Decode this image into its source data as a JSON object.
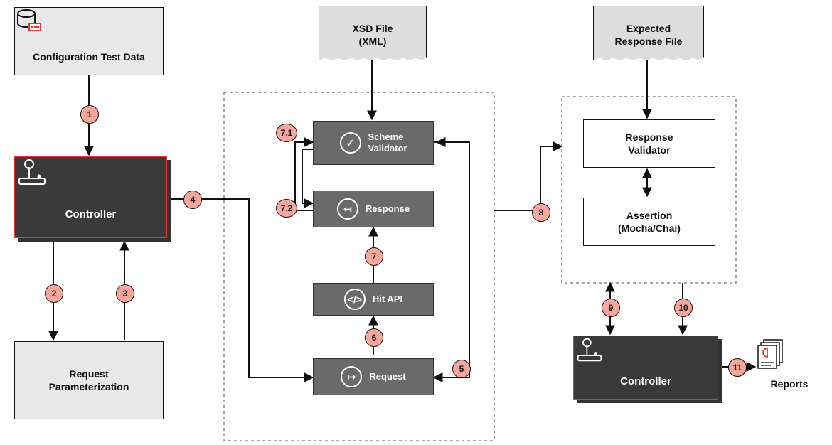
{
  "boxes": {
    "config": "Configuration Test Data",
    "controller1": "Controller",
    "reqparam_l1": "Request",
    "reqparam_l2": "Parameterization",
    "xsd_l1": "XSD File",
    "xsd_l2": "(XML)",
    "scheme_l1": "Scheme",
    "scheme_l2": "Validator",
    "response": "Response",
    "hitapi": "Hit API",
    "request": "Request",
    "expected_l1": "Expected",
    "expected_l2": "Response File",
    "respval_l1": "Response",
    "respval_l2": "Validator",
    "assert_l1": "Assertion",
    "assert_l2": "(Mocha/Chai)",
    "controller2": "Controller",
    "reports": "Reports"
  },
  "steps": {
    "s1": "1",
    "s2": "2",
    "s3": "3",
    "s4": "4",
    "s5": "5",
    "s6": "6",
    "s7": "7",
    "s71": "7.1",
    "s72": "7.2",
    "s8": "8",
    "s9": "9",
    "s10": "10",
    "s11": "11"
  },
  "chart_data": {
    "type": "table",
    "title": "API Testing / Validation Pipeline",
    "nodes": [
      {
        "id": "config",
        "label": "Configuration Test Data",
        "kind": "data"
      },
      {
        "id": "controller1",
        "label": "Controller",
        "kind": "process"
      },
      {
        "id": "reqparam",
        "label": "Request Parameterization",
        "kind": "process"
      },
      {
        "id": "xsd",
        "label": "XSD File (XML)",
        "kind": "file"
      },
      {
        "id": "scheme",
        "label": "Scheme Validator",
        "kind": "process"
      },
      {
        "id": "response",
        "label": "Response",
        "kind": "process"
      },
      {
        "id": "hitapi",
        "label": "Hit API",
        "kind": "process"
      },
      {
        "id": "request",
        "label": "Request",
        "kind": "process"
      },
      {
        "id": "expected",
        "label": "Expected Response File",
        "kind": "file"
      },
      {
        "id": "respval",
        "label": "Response Validator",
        "kind": "process"
      },
      {
        "id": "assertion",
        "label": "Assertion (Mocha/Chai)",
        "kind": "process"
      },
      {
        "id": "controller2",
        "label": "Controller",
        "kind": "process"
      },
      {
        "id": "reports",
        "label": "Reports",
        "kind": "output"
      }
    ],
    "edges": [
      {
        "step": "1",
        "from": "config",
        "to": "controller1"
      },
      {
        "step": "2",
        "from": "controller1",
        "to": "reqparam"
      },
      {
        "step": "3",
        "from": "reqparam",
        "to": "controller1"
      },
      {
        "step": "4",
        "from": "controller1",
        "to": "request"
      },
      {
        "step": "5",
        "from": "controller1",
        "to": "request",
        "note": "via right path"
      },
      {
        "step": "6",
        "from": "request",
        "to": "hitapi"
      },
      {
        "step": "7",
        "from": "hitapi",
        "to": "response"
      },
      {
        "step": "7.1",
        "from": "response",
        "to": "scheme"
      },
      {
        "step": "7.2",
        "from": "scheme",
        "to": "response",
        "note": "return"
      },
      {
        "step": "",
        "from": "xsd",
        "to": "scheme"
      },
      {
        "step": "8",
        "from": "response",
        "to": "respval",
        "note": "via right group"
      },
      {
        "step": "",
        "from": "expected",
        "to": "respval"
      },
      {
        "step": "",
        "from": "respval",
        "to": "assertion",
        "bidirectional": true
      },
      {
        "step": "9",
        "from": "assertion",
        "to": "controller2",
        "bidirectional": true
      },
      {
        "step": "10",
        "from": "assertion",
        "to": "controller2"
      },
      {
        "step": "11",
        "from": "controller2",
        "to": "reports"
      }
    ]
  }
}
